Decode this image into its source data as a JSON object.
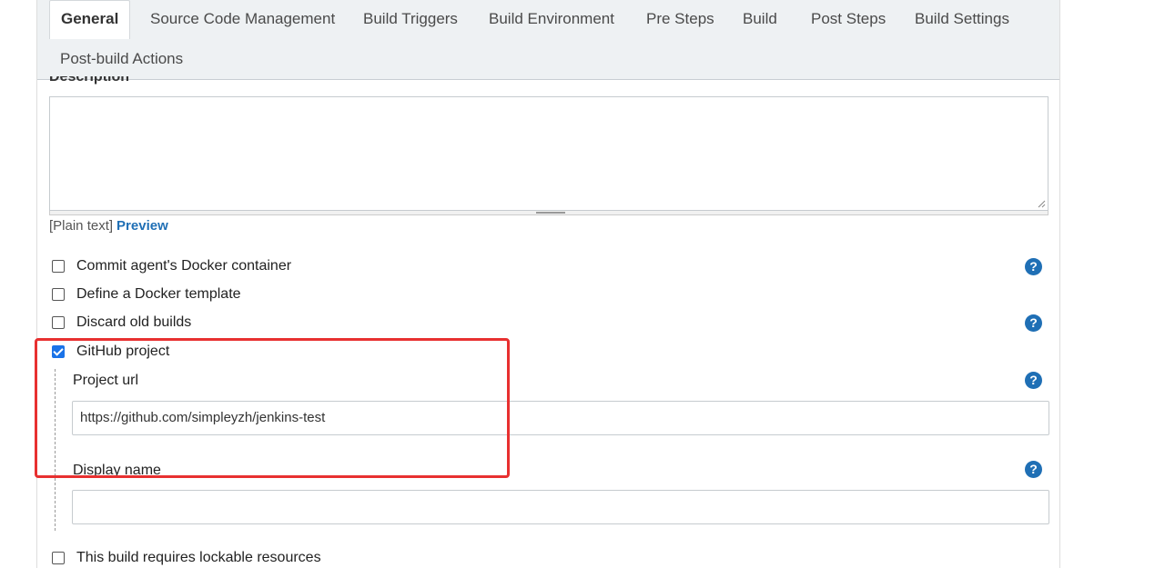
{
  "tabs": [
    {
      "label": "General",
      "active": true
    },
    {
      "label": "Source Code Management"
    },
    {
      "label": "Build Triggers"
    },
    {
      "label": "Build Environment"
    },
    {
      "label": "Pre Steps"
    },
    {
      "label": "Build"
    },
    {
      "label": "Post Steps"
    },
    {
      "label": "Build Settings"
    },
    {
      "label": "Post-build Actions"
    }
  ],
  "description": {
    "label": "Description",
    "value": "",
    "format_text": "[Plain text]",
    "preview_link": "Preview"
  },
  "options": [
    {
      "label": "Commit agent's Docker container",
      "checked": false,
      "help": true
    },
    {
      "label": "Define a Docker template",
      "checked": false,
      "help": false
    },
    {
      "label": "Discard old builds",
      "checked": false,
      "help": true
    },
    {
      "label": "GitHub project",
      "checked": true,
      "help": false
    }
  ],
  "github": {
    "project_url_label": "Project url",
    "project_url_value": "https://github.com/simpleyzh/jenkins-test",
    "display_name_label": "Display name",
    "display_name_value": ""
  },
  "lockable": {
    "label": "This build requires lockable resources",
    "checked": false
  },
  "help_glyph": "?",
  "colors": {
    "accent": "#1f6fb5",
    "highlight": "#e83030",
    "checkbox": "#1a73e8"
  }
}
